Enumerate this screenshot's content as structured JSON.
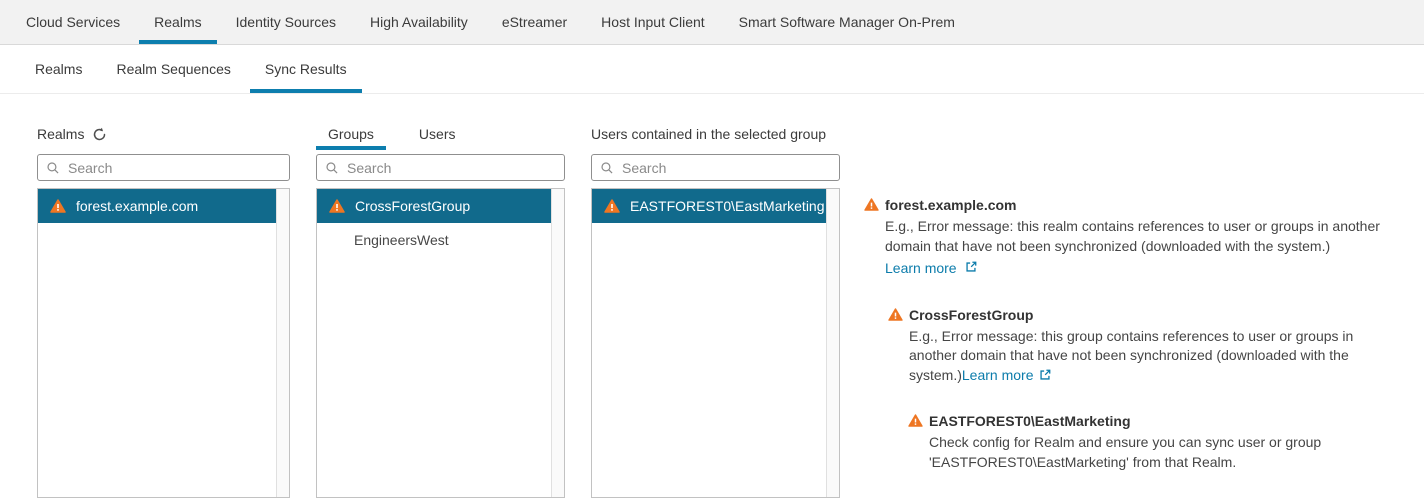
{
  "colors": {
    "accent_underline": "#0d7eae",
    "selected_row_bg": "#116a8c",
    "warning_orange": "#ee7623",
    "link_blue": "#0c7cab",
    "topnav_bg": "#f2f2f2"
  },
  "primary_nav": {
    "items": [
      {
        "label": "Cloud Services",
        "active": false
      },
      {
        "label": "Realms",
        "active": true
      },
      {
        "label": "Identity Sources",
        "active": false
      },
      {
        "label": "High Availability",
        "active": false
      },
      {
        "label": "eStreamer",
        "active": false
      },
      {
        "label": "Host Input Client",
        "active": false
      },
      {
        "label": "Smart Software Manager On-Prem",
        "active": false
      }
    ]
  },
  "secondary_nav": {
    "items": [
      {
        "label": "Realms",
        "active": false
      },
      {
        "label": "Realm Sequences",
        "active": false
      },
      {
        "label": "Sync Results",
        "active": true
      }
    ]
  },
  "realms_panel": {
    "title": "Realms",
    "refresh_icon": "refresh-icon",
    "search_placeholder": "Search",
    "items": [
      {
        "label": "forest.example.com",
        "selected": true,
        "warning": true
      }
    ]
  },
  "groups_panel": {
    "tabs": [
      {
        "label": "Groups",
        "active": true
      },
      {
        "label": "Users",
        "active": false
      }
    ],
    "search_placeholder": "Search",
    "items": [
      {
        "label": "CrossForestGroup",
        "selected": true,
        "warning": true
      },
      {
        "label": "EngineersWest",
        "selected": false,
        "warning": false
      }
    ]
  },
  "users_panel": {
    "title": "Users contained in the selected group",
    "search_placeholder": "Search",
    "items": [
      {
        "label": "EASTFOREST0\\EastMarketing",
        "selected": true,
        "warning": true
      }
    ]
  },
  "details": {
    "blocks": [
      {
        "title": "forest.example.com",
        "body": "E.g., Error message: this realm contains references to user or groups in another\ndomain that have not been synchronized (downloaded with the system.)",
        "link_label": "Learn more"
      },
      {
        "title": "CrossForestGroup",
        "body": "E.g., Error message: this group contains references to user or groups in\nanother domain that have not been synchronized (downloaded with the\nsystem.)",
        "link_label": "Learn more"
      },
      {
        "title": "EASTFOREST0\\EastMarketing",
        "body": "Check config for Realm and ensure you can sync user or group\n'EASTFOREST0\\EastMarketing' from that Realm."
      }
    ]
  }
}
